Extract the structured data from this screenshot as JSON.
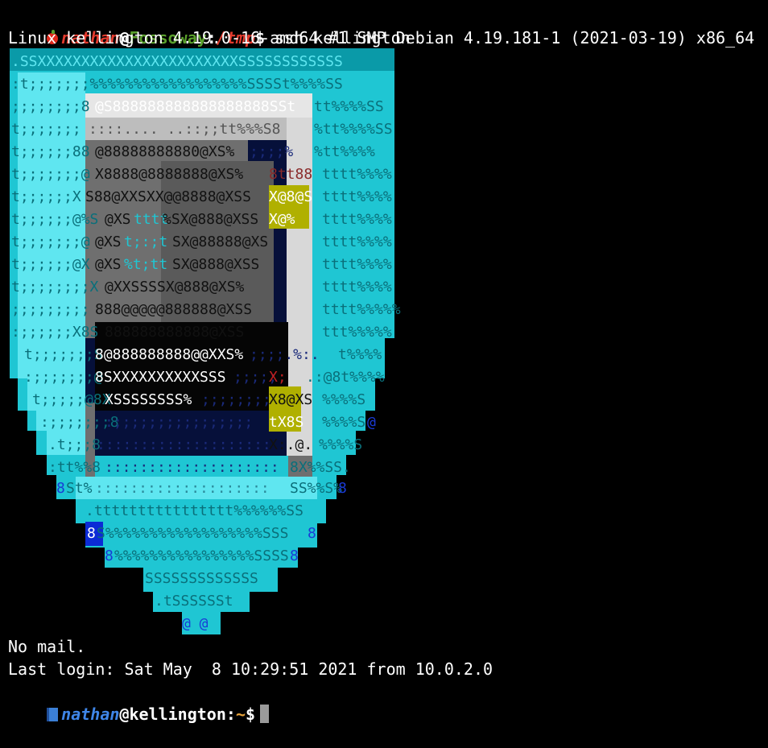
{
  "prompt1": {
    "user": "nathan",
    "at": "@",
    "host": "Fossoway",
    "colon": ":",
    "path": "/tmp",
    "dollar": "$",
    "command": " ssh kellington",
    "colors": {
      "user": "#e33b2e",
      "host": "#5aa02c",
      "path": "#e33b2e"
    }
  },
  "banner": "Linux kellington 4.19.0-16-amd64 #1 SMP Debian 4.19.181-1 (2021-03-19) x86_64",
  "shield_art": {
    "description_icon": "debian-shield-ascii-art",
    "colors": {
      "cyan": "#1fc6d3",
      "light_cyan": "#5fe6f0",
      "dark_cyan": "#0a8f9c",
      "gray": "#6f6f6f",
      "light_gray": "#bdbdbd",
      "white_gray": "#e6e6e6",
      "navy": "#06103a",
      "yellow": "#b0b000",
      "blue": "#0b2bd6"
    },
    "rows": [
      ".SSXXXXXXXXXXXXXXXXXXXXXXSSSSSSSSSS$SS",
      ":t;;;;;;;%%%%%%%%%%%%%%%%%%SSSSt%%%%SS",
      ";;;;;;;;8@S888888888888888SSt%t%%%%SS",
      "t;;;;;;;::::....  ..::;;tt%%%S8%t%%%%SS",
      "t;;;;;;88@88888888880@XS%;;;;%:.%tt%%%%",
      "t;;;;;;;@X8888@8888888@XS%;8tt88tttt%%%%",
      "t;;;;;;XS88@XXSXX@@8888@XSSX@8@Stttt%%%%",
      "t;;;;;;@%S@XStttt%SX@888@XSSX@%:.tttt%%%%",
      "t;;;;;;;@@XSt;:;tSX@88888@XS8;:.tttt%%%%",
      "t;;;;;;@X@XS%t;ttSX@888@XSS;;:.tttt%%%%",
      "t;;;;;;;;X@XXSSSSX@888@XS%;;:.tttt%%%%",
      ";;;;;;;;;888@@@@@888888@XSS;;:.tttt%%%%",
      ":;;;;;;X8S888888888888@XSS;;;:.ttt%%%%%",
      "t;;;;;;;S8@888888888@@XXS%;;;;.%:.t%%%%",
      ":;;;;;;;@8SXXXXXXXXXXSSS;;;;;X;.:@8t%%%%",
      "t;;;;;@8XXSSSSSSSS%;;;;;;;;X8@XS%%%%S",
      ":;;;;;;;8:;;;;;;;;;;;;;;;;tX8S%%%%S@",
      ".t;;;8::::::::::::::::::::X:.@.%%%%S",
      ":tt%%8::::::::::::::::::::8X%%SS.",
      "8St%::::::::::::::::::::::SS%%S%8",
      ".tttttttttttttttt%%%%%%SS",
      "8S%%%%%%%%%%%%%%%%%%SSS8",
      "8%%%%%%%%%%%%%%%%SSSS8",
      "SSSSSSSSSSSSS",
      ".tSSSSSSt",
      "@ @"
    ]
  },
  "motd": {
    "no_mail": "No mail.",
    "last_login": "Last login: Sat May  8 10:29:51 2021 from 10.0.2.0"
  },
  "prompt2": {
    "user": "nathan",
    "at": "@",
    "host": "kellington",
    "colon": ":",
    "path": "~",
    "dollar": "$",
    "colors": {
      "user": "#3f86e8",
      "path": "#e8a33b"
    }
  }
}
